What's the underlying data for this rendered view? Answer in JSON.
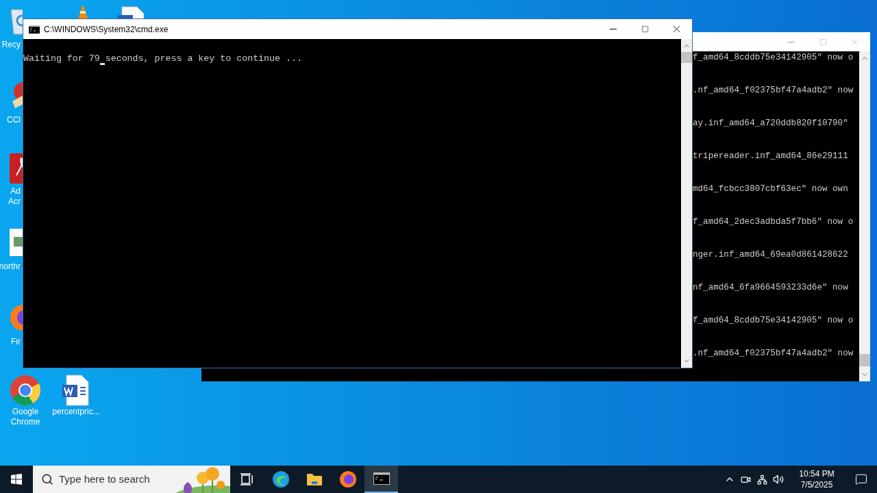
{
  "desktop_icons": [
    {
      "kind": "recycle",
      "lines": [
        "Recy"
      ]
    },
    {
      "kind": "cleaner",
      "lines": [
        "CCl"
      ]
    },
    {
      "kind": "acrobat",
      "lines": [
        "Ad",
        "Acr"
      ]
    },
    {
      "kind": "image",
      "lines": [
        "northr"
      ]
    },
    {
      "kind": "firefox",
      "lines": [
        "Fir"
      ]
    },
    {
      "kind": "chrome",
      "lines": [
        "Google",
        "Chrome"
      ]
    },
    {
      "kind": "word",
      "lines": [
        "percentpric..."
      ]
    },
    {
      "kind": "vlc"
    },
    {
      "kind": "word"
    }
  ],
  "background_window": {
    "lines": [
      "f_amd64_8cddb75e34142905\" now o",
      ".nf_amd64_f02375bf47a4adb2\" now",
      "ay.inf_amd64_a720ddb820f10790\"",
      "tripereader.inf_amd64_86e29111",
      "md64_fcbcc3807cbf63ec\" now own",
      "f_amd64_2dec3adbda5f7bb6\" now o",
      "nger.inf_amd64_69ea0d861428622",
      "nf_amd64_6fa9664593233d6e\" now",
      "f_amd64_8cddb75e34142905\" now o",
      ".nf_amd64_f02375bf47a4adb2\" now"
    ]
  },
  "cmd_window": {
    "title": "C:\\WINDOWS\\System32\\cmd.exe",
    "lines": [
      "Waiting for 79 seconds, press a key to continue ..."
    ],
    "cursor_visible": true
  },
  "taskbar": {
    "search": {
      "placeholder": "Type here to search"
    },
    "apps": [
      {
        "kind": "taskview",
        "selected": false
      },
      {
        "kind": "edge",
        "selected": false
      },
      {
        "kind": "explorer",
        "selected": false
      },
      {
        "kind": "firefox",
        "selected": false
      },
      {
        "kind": "terminal",
        "selected": true
      }
    ],
    "clock": {
      "time": "10:54 PM",
      "date": "7/5/2025"
    }
  }
}
